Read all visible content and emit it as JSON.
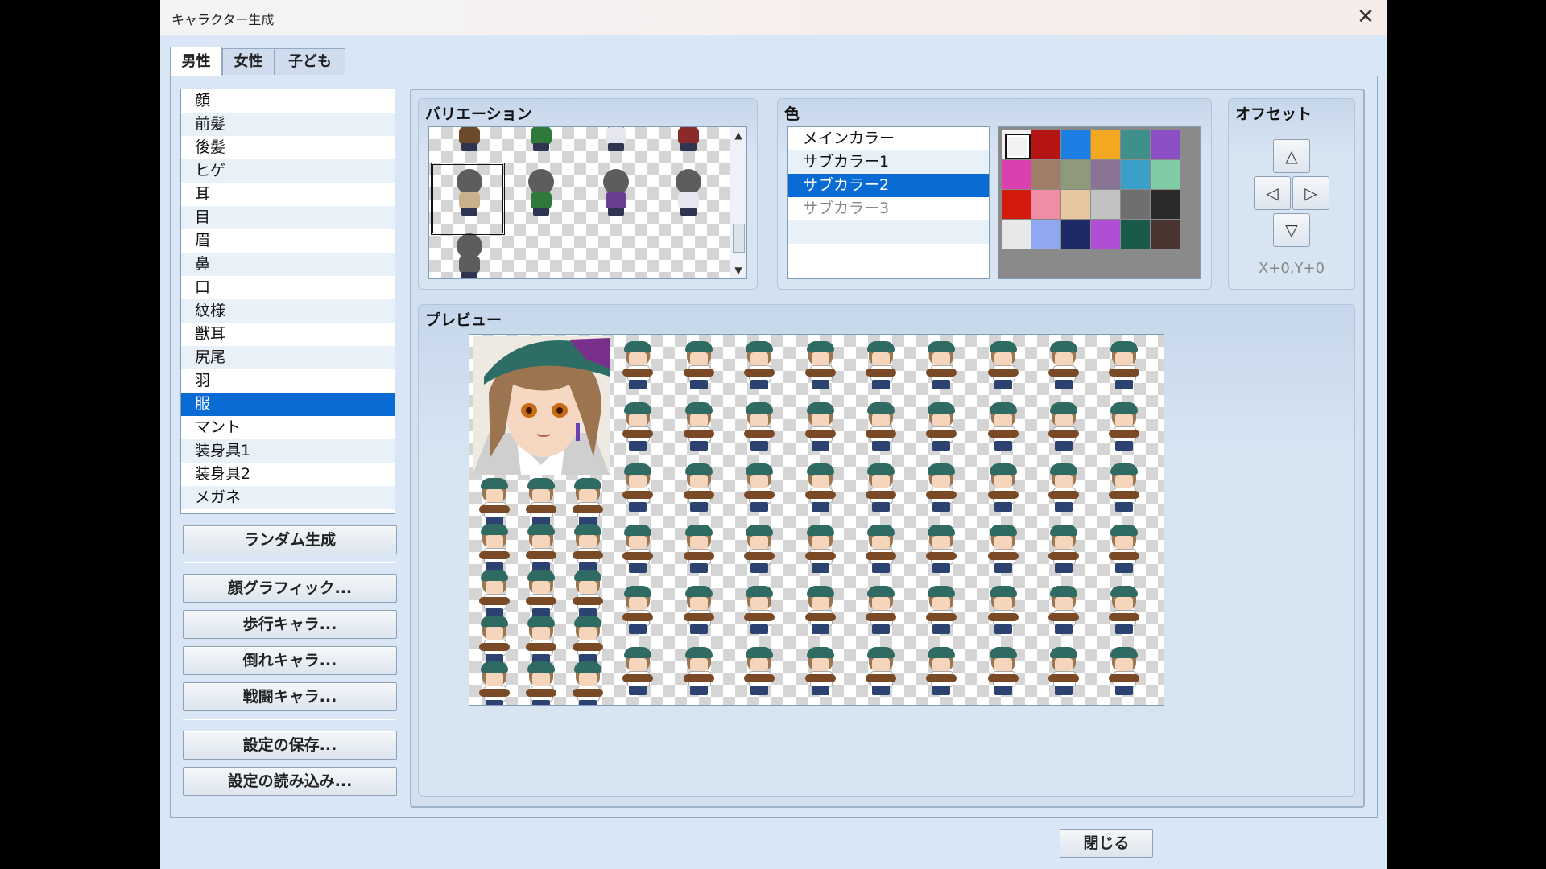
{
  "window": {
    "title": "キャラクター生成",
    "close_glyph": "✕"
  },
  "tabs": [
    {
      "label": "男性",
      "active": true
    },
    {
      "label": "女性",
      "active": false
    },
    {
      "label": "子ども",
      "active": false
    }
  ],
  "parts": {
    "selected_index": 13,
    "items": [
      "顔",
      "前髪",
      "後髪",
      "ヒゲ",
      "耳",
      "目",
      "眉",
      "鼻",
      "口",
      "紋様",
      "獣耳",
      "尻尾",
      "羽",
      "服",
      "マント",
      "装身具1",
      "装身具2",
      "メガネ"
    ]
  },
  "buttons": {
    "random": "ランダム生成",
    "face_graphic": "顔グラフィック...",
    "walk_char": "歩行キャラ...",
    "down_char": "倒れキャラ...",
    "battle_char": "戦闘キャラ...",
    "save_settings": "設定の保存...",
    "load_settings": "設定の読み込み...",
    "close": "閉じる"
  },
  "variation": {
    "title": "バリエーション",
    "body_colors": [
      "#6b4a2a",
      "#2f7a3a",
      "#e6e6f0",
      "#8a2a2a",
      "#c9b08a",
      "#2f7a3a",
      "#6a3f8f",
      "#e6e6f0",
      "#5d5d5d"
    ],
    "scroll_up": "▲",
    "scroll_down": "▼"
  },
  "color": {
    "title": "色",
    "items": [
      {
        "label": "メインカラー",
        "state": "normal"
      },
      {
        "label": "サブカラー1",
        "state": "normal"
      },
      {
        "label": "サブカラー2",
        "state": "selected"
      },
      {
        "label": "サブカラー3",
        "state": "disabled"
      }
    ],
    "swatches": [
      "#f2f2f2",
      "#b51414",
      "#1c7fe3",
      "#f2a820",
      "#3f8f8a",
      "#8c4fc6",
      "#dc3fb0",
      "#a07d66",
      "#8f9a7c",
      "#8a7494",
      "#3aa0c9",
      "#7fcba3",
      "#d21a0d",
      "#ef8da4",
      "#e7c7a0",
      "#c2c2c2",
      "#6f6f6f",
      "#2a2a2a",
      "#e8e8e8",
      "#8fa8ef",
      "#1e2a66",
      "#b04fd6",
      "#1a5a4a",
      "#4a3630"
    ]
  },
  "offset": {
    "title": "オフセット",
    "up": "△",
    "left": "◁",
    "right": "▷",
    "down": "▽",
    "value": "X+0,Y+0"
  },
  "preview": {
    "title": "プレビュー"
  }
}
